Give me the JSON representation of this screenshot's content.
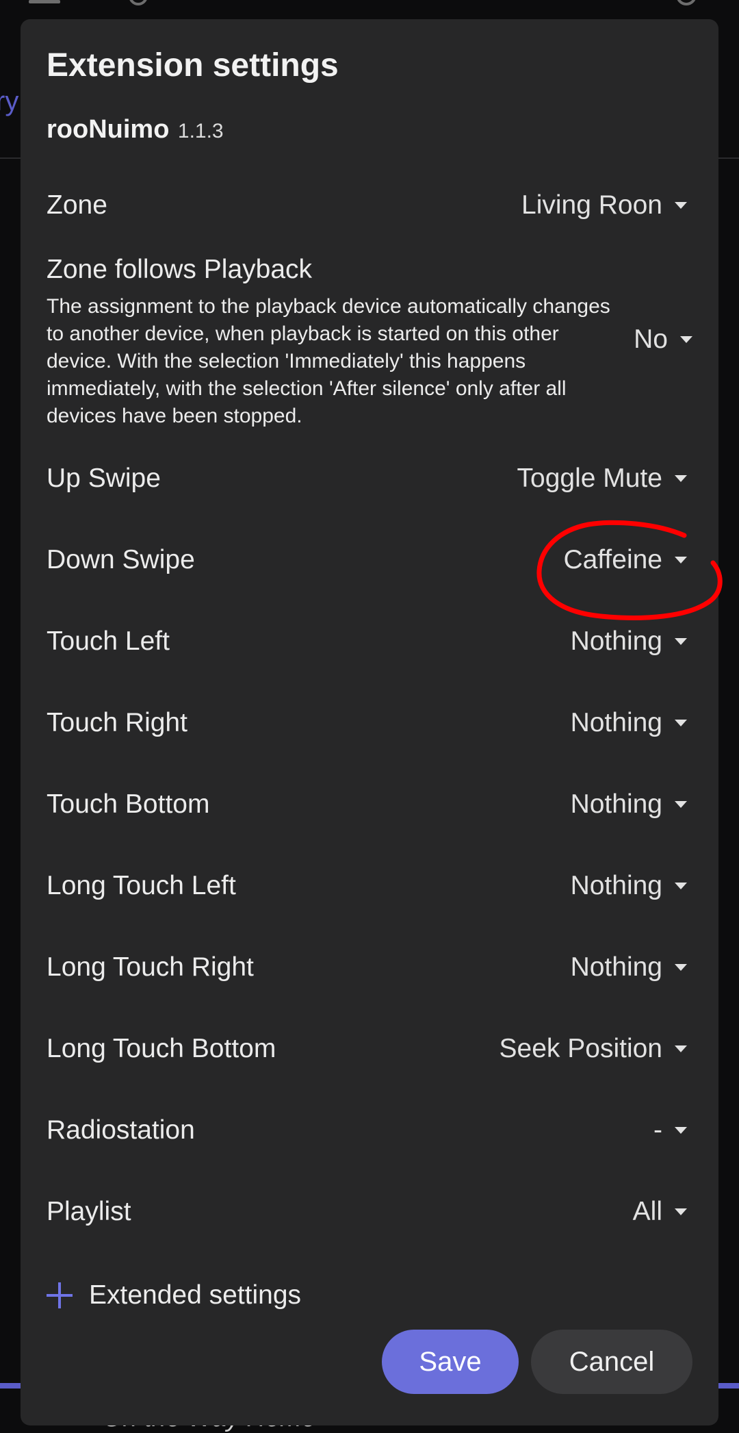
{
  "dialog": {
    "title": "Extension settings",
    "extension_name": "rooNuimo",
    "extension_version": "1.1.3"
  },
  "background": {
    "side_text": "ry",
    "bottom_text": "On the Way Home"
  },
  "settings": {
    "zone": {
      "label": "Zone",
      "value": "Living Roon"
    },
    "zone_follows": {
      "label": "Zone follows Playback",
      "description": "The assignment to the playback device automatically changes to another device, when playback is started on this other device. With the selection 'Immediately' this happens immediately, with the selection 'After silence' only after all devices have been stopped.",
      "value": "No"
    },
    "up_swipe": {
      "label": "Up Swipe",
      "value": "Toggle Mute"
    },
    "down_swipe": {
      "label": "Down Swipe",
      "value": "Caffeine"
    },
    "touch_left": {
      "label": "Touch Left",
      "value": "Nothing"
    },
    "touch_right": {
      "label": "Touch Right",
      "value": "Nothing"
    },
    "touch_bottom": {
      "label": "Touch Bottom",
      "value": "Nothing"
    },
    "long_touch_left": {
      "label": "Long Touch Left",
      "value": "Nothing"
    },
    "long_touch_right": {
      "label": "Long Touch Right",
      "value": "Nothing"
    },
    "long_touch_bottom": {
      "label": "Long Touch Bottom",
      "value": "Seek Position"
    },
    "radiostation": {
      "label": "Radiostation",
      "value": "-"
    },
    "playlist": {
      "label": "Playlist",
      "value": "All"
    }
  },
  "extended": {
    "label": "Extended settings",
    "icon": "plus-icon"
  },
  "buttons": {
    "save": "Save",
    "cancel": "Cancel"
  },
  "colors": {
    "accent": "#6b6fdb",
    "dialog_bg": "#272728",
    "annotation": "#ff0000"
  }
}
